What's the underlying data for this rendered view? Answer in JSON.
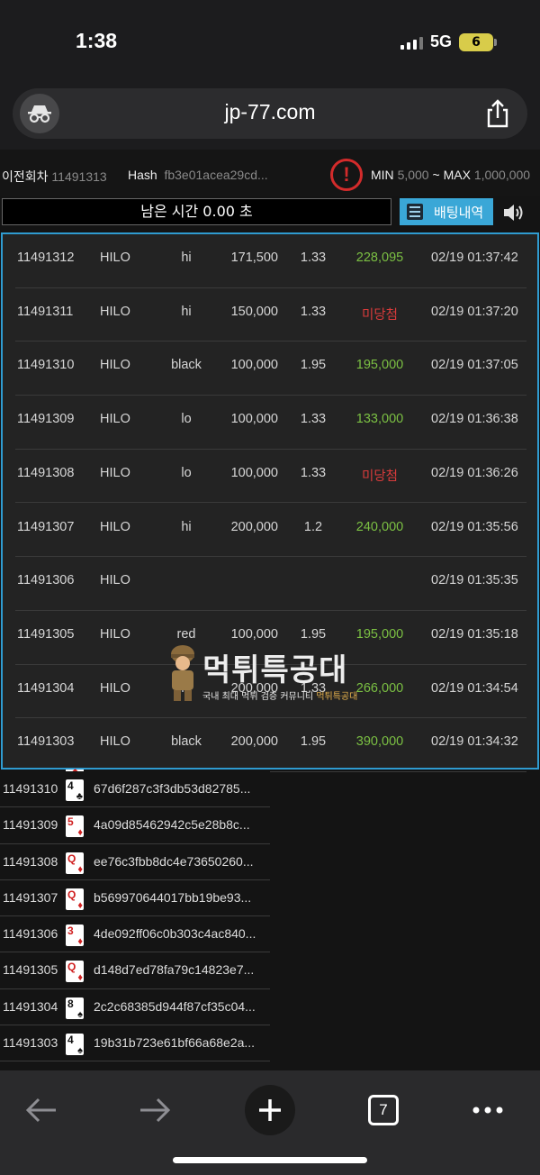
{
  "status_bar": {
    "time": "1:38",
    "network": "5G",
    "battery": "6"
  },
  "browser": {
    "url": "jp-77.com",
    "tabs_count": "7"
  },
  "game_header": {
    "prev_round_label": "이전회차",
    "prev_round_value": "11491313",
    "hash_label": "Hash",
    "hash_value": "fb3e01acea29cd...",
    "alert_symbol": "!",
    "min_label": "MIN",
    "min_value": "5,000",
    "separator": "~",
    "max_label": "MAX",
    "max_value": "1,000,000",
    "timer_text": "남은 시간 0.00 초",
    "bet_history_label": "배팅내역"
  },
  "bet_history": [
    {
      "round": "11491312",
      "game": "HILO",
      "pick": "hi",
      "amount": "171,500",
      "odds": "1.33",
      "result": "228,095",
      "result_type": "win",
      "time": "02/19 01:37:42"
    },
    {
      "round": "11491311",
      "game": "HILO",
      "pick": "hi",
      "amount": "150,000",
      "odds": "1.33",
      "result": "미당첨",
      "result_type": "lose",
      "time": "02/19 01:37:20"
    },
    {
      "round": "11491310",
      "game": "HILO",
      "pick": "black",
      "amount": "100,000",
      "odds": "1.95",
      "result": "195,000",
      "result_type": "win",
      "time": "02/19 01:37:05"
    },
    {
      "round": "11491309",
      "game": "HILO",
      "pick": "lo",
      "amount": "100,000",
      "odds": "1.33",
      "result": "133,000",
      "result_type": "win",
      "time": "02/19 01:36:38"
    },
    {
      "round": "11491308",
      "game": "HILO",
      "pick": "lo",
      "amount": "100,000",
      "odds": "1.33",
      "result": "미당첨",
      "result_type": "lose",
      "time": "02/19 01:36:26"
    },
    {
      "round": "11491307",
      "game": "HILO",
      "pick": "hi",
      "amount": "200,000",
      "odds": "1.2",
      "result": "240,000",
      "result_type": "win",
      "time": "02/19 01:35:56"
    },
    {
      "round": "11491306",
      "game": "HILO",
      "pick": "",
      "amount": "",
      "odds": "",
      "result": "",
      "result_type": "win",
      "time": "02/19 01:35:35"
    },
    {
      "round": "11491305",
      "game": "HILO",
      "pick": "red",
      "amount": "100,000",
      "odds": "1.95",
      "result": "195,000",
      "result_type": "win",
      "time": "02/19 01:35:18"
    },
    {
      "round": "11491304",
      "game": "HILO",
      "pick": "hi",
      "amount": "200,000",
      "odds": "1.33",
      "result": "266,000",
      "result_type": "win",
      "time": "02/19 01:34:54"
    },
    {
      "round": "11491303",
      "game": "HILO",
      "pick": "black",
      "amount": "200,000",
      "odds": "1.95",
      "result": "390,000",
      "result_type": "win",
      "time": "02/19 01:34:32"
    }
  ],
  "card_history": [
    {
      "round": "11491310",
      "rank": "4",
      "suit": "♣",
      "color": "black",
      "hash": "67d6f287c3f3db53d82785..."
    },
    {
      "round": "11491309",
      "rank": "5",
      "suit": "♦",
      "color": "red",
      "hash": "4a09d85462942c5e28b8c..."
    },
    {
      "round": "11491308",
      "rank": "Q",
      "suit": "♦",
      "color": "red",
      "hash": "ee76c3fbb8dc4e73650260..."
    },
    {
      "round": "11491307",
      "rank": "Q",
      "suit": "♦",
      "color": "red",
      "hash": "b569970644017bb19be93..."
    },
    {
      "round": "11491306",
      "rank": "3",
      "suit": "♦",
      "color": "red",
      "hash": "4de092ff06c0b303c4ac840..."
    },
    {
      "round": "11491305",
      "rank": "Q",
      "suit": "♦",
      "color": "red",
      "hash": "d148d7ed78fa79c14823e7..."
    },
    {
      "round": "11491304",
      "rank": "8",
      "suit": "♠",
      "color": "black",
      "hash": "2c2c68385d944f87cf35c04..."
    },
    {
      "round": "11491303",
      "rank": "4",
      "suit": "♠",
      "color": "black",
      "hash": "19b31b723e61bf66a68e2a..."
    }
  ],
  "watermark": {
    "title": "먹튀특공대",
    "subtitle_main": "국내 최대 먹튀 검증 커뮤니티",
    "subtitle_accent": "먹튀특공대"
  },
  "colors": {
    "accent": "#3aa7d7",
    "win": "#7bc043",
    "lose": "#d83b3b"
  },
  "icons": [
    "incognito-icon",
    "share-icon",
    "alert-icon",
    "list-icon",
    "speaker-icon",
    "back-arrow-icon",
    "forward-arrow-icon",
    "plus-icon",
    "tabs-icon",
    "more-icon"
  ]
}
